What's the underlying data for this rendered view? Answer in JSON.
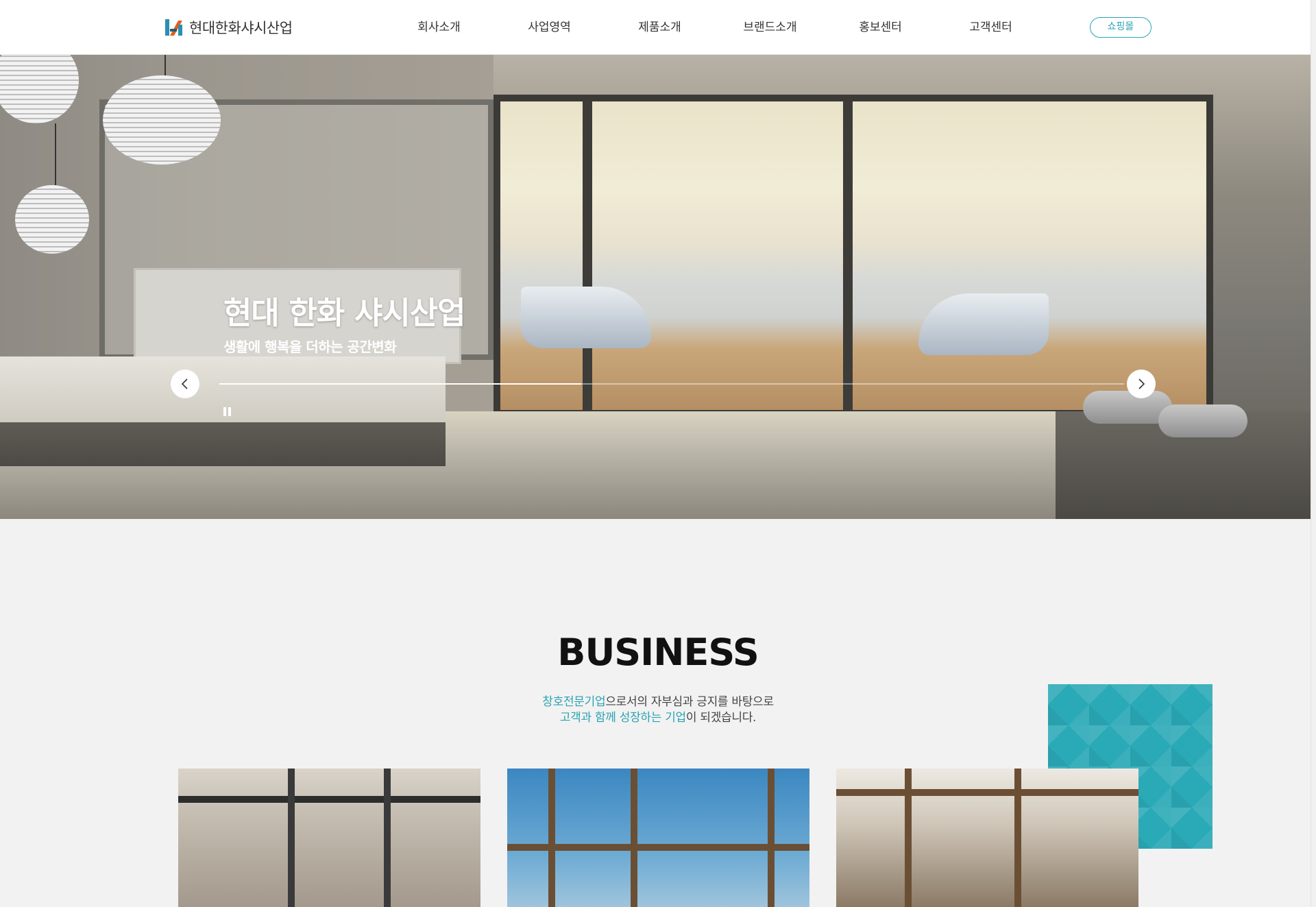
{
  "header": {
    "logo_text": "현대한화샤시산업",
    "nav": [
      "회사소개",
      "사업영역",
      "제품소개",
      "브랜드소개",
      "홍보센터",
      "고객센터"
    ],
    "shop_label": "쇼핑몰"
  },
  "hero": {
    "title": "현대 한화 샤시산업",
    "subtitle": "생활에 행복을 더하는 공간변화",
    "slide_progress": 0.4
  },
  "business": {
    "title": "BUSINESS",
    "line1_accent": "창호전문기업",
    "line1_rest": "으로서의 자부심과 긍지를 바탕으로",
    "line2_accent": "고객과 함께 성장하는 기업",
    "line2_rest": "이 되겠습니다."
  },
  "colors": {
    "accent": "#2aa4b3",
    "teal_square": "#2aa9b6"
  },
  "icons": {
    "prev": "chevron-left-icon",
    "next": "chevron-right-icon",
    "pause": "pause-icon"
  }
}
